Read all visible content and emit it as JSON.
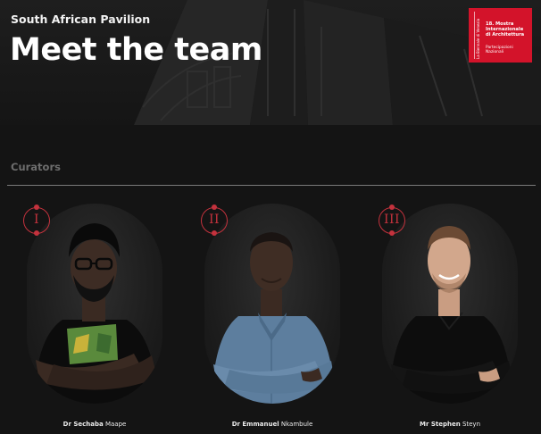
{
  "header": {
    "pavilion": "South African Pavilion",
    "title": "Meet the team"
  },
  "badge": {
    "vertical_text": "La Biennale di Venezia",
    "line1": "18. Mostra",
    "line2": "Internazionale",
    "line3": "di Architettura",
    "subline": "Partecipazioni Nazionali",
    "color": "#d3132a"
  },
  "section": {
    "label": "Curators"
  },
  "team": [
    {
      "numeral": "I",
      "title": "Dr Sechaba",
      "surname": "Maape"
    },
    {
      "numeral": "II",
      "title": "Dr Emmanuel",
      "surname": "Nkambule"
    },
    {
      "numeral": "III",
      "title": "Mr Stephen",
      "surname": "Steyn"
    }
  ],
  "colors": {
    "accent": "#c4323d",
    "background": "#141414"
  }
}
